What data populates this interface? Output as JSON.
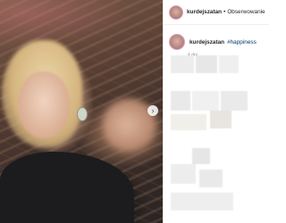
{
  "post": {
    "username": "kurdejszatan",
    "follow_label": "Obserwowanie",
    "separator": "•",
    "caption_hashtag": "#happiness",
    "time_ago": "4 dni"
  },
  "icons": {
    "next": "chevron-right-icon"
  }
}
